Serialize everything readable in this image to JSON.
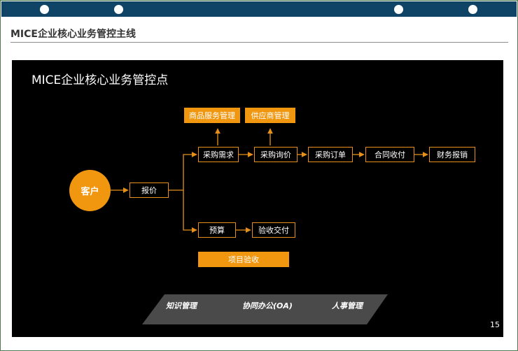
{
  "header": {
    "section_title": "MICE企业核心业务管控主线"
  },
  "slide": {
    "title": "MICE企业核心业务管控点",
    "page_number": "15",
    "customer": "客户",
    "nodes": {
      "quote": "报价",
      "procure_request": "采购需求",
      "procure_inquiry": "采购询价",
      "procure_order": "采购订单",
      "contract_collection": "合同收付",
      "finance_reimburse": "财务报销",
      "product_service_mgmt": "商品服务管理",
      "supplier_mgmt": "供应商管理",
      "budget": "预算",
      "acceptance_delivery": "验收交付",
      "project_acceptance": "项目验收"
    },
    "tools": [
      "知识管理",
      "协同办公(OA)",
      "人事管理"
    ]
  },
  "colors": {
    "accent": "#f0960f",
    "connector": "#e69019",
    "header_bar": "#0f4466",
    "slide_bg": "#000000",
    "tools_band": "#4a4a4a"
  }
}
